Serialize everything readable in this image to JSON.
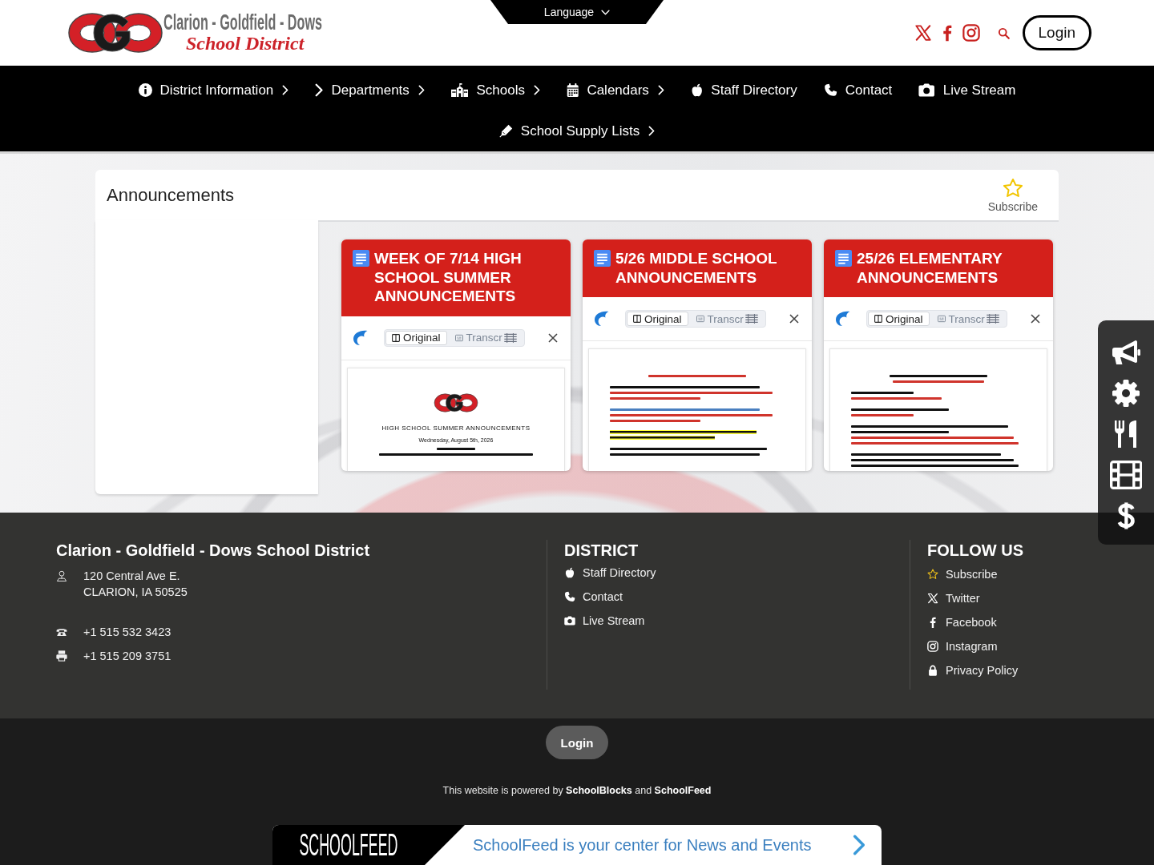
{
  "header": {
    "logo": {
      "line_1": "Clarion - Goldfield - Dows",
      "line_2": "School District"
    },
    "language": "Language",
    "login": "Login"
  },
  "nav": [
    {
      "label": "District Information",
      "kind": "info",
      "submenu": true
    },
    {
      "label": "Departments",
      "kind": "chevron",
      "submenu": true
    },
    {
      "label": "Schools",
      "kind": "school",
      "submenu": true
    },
    {
      "label": "Calendars",
      "kind": "calendar",
      "submenu": true
    },
    {
      "label": "Staff Directory",
      "kind": "apple",
      "submenu": false
    },
    {
      "label": "Contact",
      "kind": "phone",
      "submenu": false
    },
    {
      "label": "Live Stream",
      "kind": "camera",
      "submenu": false
    },
    {
      "label": "School Supply Lists",
      "kind": "pen",
      "submenu": true
    }
  ],
  "announcements": {
    "title": "Announcements",
    "subscribe": "Subscribe",
    "cards": [
      {
        "title": "WEEK OF 7/14 HIGH SCHOOL SUMMER ANNOUNCEMENTS",
        "views": [
          {
            "label": "Original",
            "selected": true
          },
          {
            "label": "Transcr",
            "selected": false
          }
        ],
        "document": [
          {
            "kind": "logo"
          },
          {
            "kind": "heading",
            "text": "HIGH SCHOOL SUMMER ANNOUNCEMENTS"
          },
          {
            "kind": "subheading",
            "text": "Wednesday, August 5th, 2026"
          },
          {
            "kind": "short-title-line",
            "color": "#111111"
          },
          {
            "kind": "wide-title-line",
            "color": "#111111"
          }
        ]
      },
      {
        "title": "5/26 MIDDLE SCHOOL ANNOUNCEMENTS",
        "views": [
          {
            "label": "Original",
            "selected": true
          },
          {
            "label": "Transcr",
            "selected": false
          }
        ],
        "document": [
          {
            "kind": "title-line",
            "color": "#d0342c"
          },
          {
            "kind": "gap"
          },
          {
            "kind": "line",
            "color": "#111111"
          },
          {
            "kind": "line",
            "color": "#d0342c"
          },
          {
            "kind": "short-line",
            "color": "#d0342c"
          },
          {
            "kind": "gap"
          },
          {
            "kind": "line",
            "color": "#4a7fc0"
          },
          {
            "kind": "line",
            "color": "#d0342c"
          },
          {
            "kind": "short-line",
            "color": "#d0342c"
          },
          {
            "kind": "gap"
          },
          {
            "kind": "highlight-line",
            "color": "#111111"
          },
          {
            "kind": "highlight-line",
            "color": "#111111"
          },
          {
            "kind": "gap"
          },
          {
            "kind": "line",
            "color": "#111111"
          },
          {
            "kind": "line",
            "color": "#111111"
          }
        ]
      },
      {
        "title": "25/26 ELEMENTARY ANNOUNCEMENTS",
        "views": [
          {
            "label": "Original",
            "selected": true
          },
          {
            "label": "Transcr",
            "selected": false
          }
        ],
        "document": [
          {
            "kind": "title-line",
            "color": "#111111"
          },
          {
            "kind": "title-line",
            "color": "#d0342c"
          },
          {
            "kind": "gap"
          },
          {
            "kind": "short-line",
            "color": "#111111"
          },
          {
            "kind": "short-line",
            "color": "#d0342c"
          },
          {
            "kind": "gap"
          },
          {
            "kind": "short-line",
            "color": "#111111"
          },
          {
            "kind": "short-line",
            "color": "#d0342c"
          },
          {
            "kind": "gap"
          },
          {
            "kind": "line",
            "color": "#111111"
          },
          {
            "kind": "short-line",
            "color": "#111111"
          },
          {
            "kind": "line",
            "color": "#d0342c"
          },
          {
            "kind": "line",
            "color": "#d0342c"
          },
          {
            "kind": "gap"
          },
          {
            "kind": "line",
            "color": "#111111"
          },
          {
            "kind": "line",
            "color": "#111111"
          },
          {
            "kind": "line",
            "color": "#111111"
          }
        ]
      }
    ]
  },
  "footer": {
    "title": "Clarion - Goldfield - Dows School District",
    "contact": [
      {
        "kind": "location",
        "lines": [
          "120 Central Ave E.",
          "CLARION, IA 50525"
        ]
      },
      {
        "kind": "telephone",
        "lines": [
          "+1 515 532 3423"
        ]
      },
      {
        "kind": "printer",
        "lines": [
          "+1 515 209 3751"
        ]
      }
    ],
    "district": {
      "heading": "DISTRICT",
      "links": [
        {
          "label": "Staff Directory",
          "kind": "apple"
        },
        {
          "label": "Contact",
          "kind": "phone"
        },
        {
          "label": "Live Stream",
          "kind": "camera"
        }
      ]
    },
    "follow": {
      "heading": "FOLLOW US",
      "links": [
        {
          "label": "Subscribe",
          "kind": "star"
        },
        {
          "label": "Twitter",
          "kind": "x"
        },
        {
          "label": "Facebook",
          "kind": "facebook"
        },
        {
          "label": "Instagram",
          "kind": "instagram"
        },
        {
          "label": "Privacy Policy",
          "kind": "lock"
        }
      ]
    }
  },
  "bottom": {
    "login": "Login",
    "powered": "This website is powered by **SchoolBlocks** and **SchoolFeed**",
    "banner": {
      "logo": "SCHOOLFEED",
      "text": "SchoolFeed is your center for News and Events"
    }
  }
}
